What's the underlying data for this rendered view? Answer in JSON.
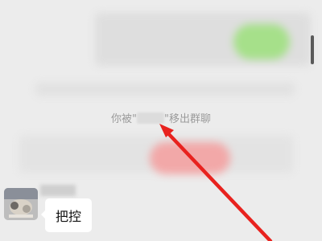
{
  "system_notice": {
    "prefix": "你被\"",
    "suffix": "\"移出群聊"
  },
  "message": {
    "text": "把控"
  },
  "colors": {
    "background": "#ececec",
    "annotation_arrow": "#e8221e",
    "bubble": "#ffffff"
  },
  "icons": {
    "annotation": "red-arrow-icon"
  }
}
